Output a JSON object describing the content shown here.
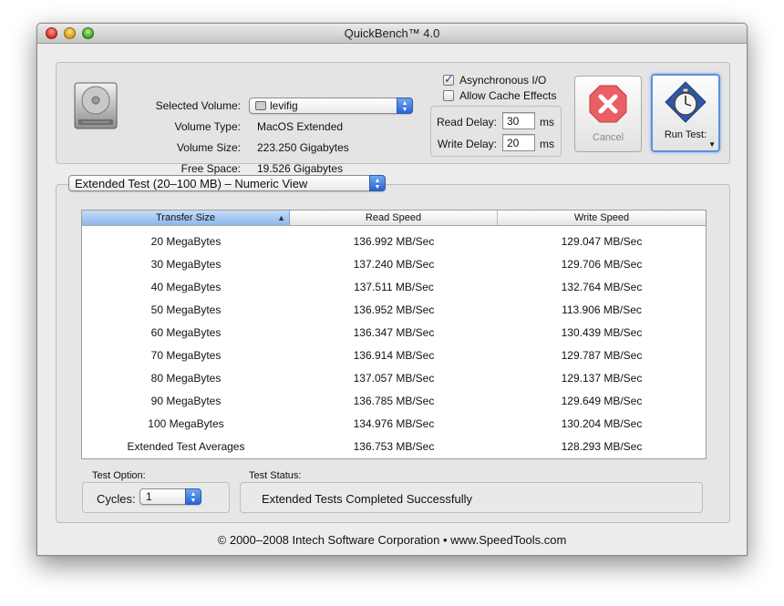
{
  "window": {
    "title": "QuickBench™ 4.0"
  },
  "volume": {
    "selected_label": "Selected Volume:",
    "selected_value": "levifig",
    "type_label": "Volume Type:",
    "type_value": "MacOS Extended",
    "size_label": "Volume Size:",
    "size_value": "223.250 Gigabytes",
    "free_label": "Free Space:",
    "free_value": "19.526 Gigabytes"
  },
  "options": {
    "async_label": "Asynchronous I/O",
    "async_checked": true,
    "cache_label": "Allow Cache Effects",
    "cache_checked": false,
    "read_delay_label": "Read Delay:",
    "read_delay_value": "30",
    "write_delay_label": "Write Delay:",
    "write_delay_value": "20",
    "ms_unit": "ms"
  },
  "buttons": {
    "cancel_label": "Cancel",
    "run_label": "Run Test:"
  },
  "test_view": {
    "selected": "Extended Test (20–100 MB) – Numeric View"
  },
  "table": {
    "columns": [
      "Transfer Size",
      "Read Speed",
      "Write Speed"
    ],
    "sort_column": "Transfer Size",
    "rows": [
      [
        "20 MegaBytes",
        "136.992 MB/Sec",
        "129.047 MB/Sec"
      ],
      [
        "30 MegaBytes",
        "137.240 MB/Sec",
        "129.706 MB/Sec"
      ],
      [
        "40 MegaBytes",
        "137.511 MB/Sec",
        "132.764 MB/Sec"
      ],
      [
        "50 MegaBytes",
        "136.952 MB/Sec",
        "113.906 MB/Sec"
      ],
      [
        "60 MegaBytes",
        "136.347 MB/Sec",
        "130.439 MB/Sec"
      ],
      [
        "70 MegaBytes",
        "136.914 MB/Sec",
        "129.787 MB/Sec"
      ],
      [
        "80 MegaBytes",
        "137.057 MB/Sec",
        "129.137 MB/Sec"
      ],
      [
        "90 MegaBytes",
        "136.785 MB/Sec",
        "129.649 MB/Sec"
      ],
      [
        "100 MegaBytes",
        "134.976 MB/Sec",
        "130.204 MB/Sec"
      ],
      [
        "Extended Test Averages",
        "136.753 MB/Sec",
        "128.293 MB/Sec"
      ]
    ]
  },
  "test_option": {
    "label": "Test Option:",
    "cycles_label": "Cycles:",
    "cycles_value": "1"
  },
  "test_status": {
    "label": "Test Status:",
    "value": "Extended Tests Completed Successfully"
  },
  "footer": {
    "text": "© 2000–2008 Intech Software Corporation • www.SpeedTools.com"
  },
  "colors": {
    "accent": "#2a64d6",
    "cancel_red": "#e8454a",
    "selected_header": "#8ab6ec"
  }
}
